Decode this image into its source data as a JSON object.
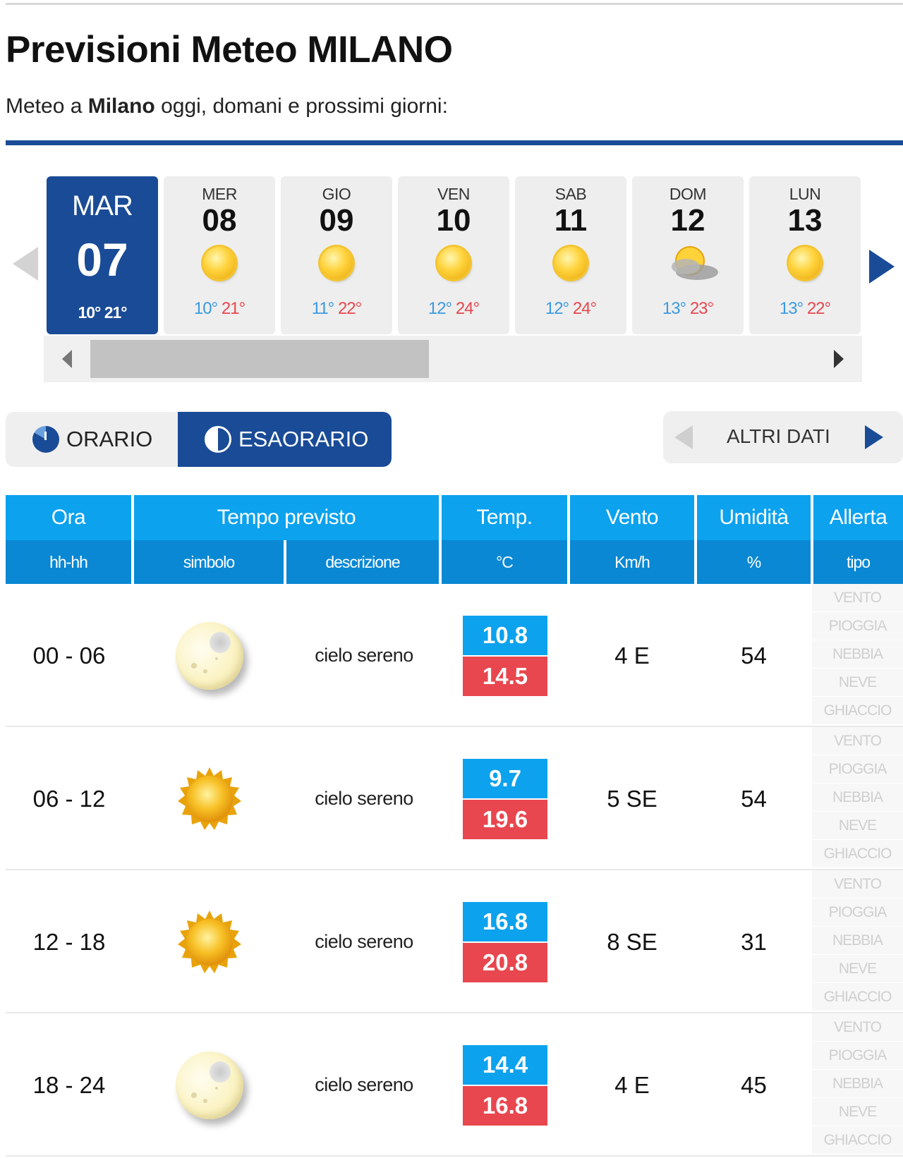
{
  "header": {
    "title": "Previsioni Meteo MILANO",
    "subtitle_pre": "Meteo a ",
    "subtitle_city": "Milano",
    "subtitle_post": " oggi, domani e prossimi giorni:"
  },
  "days": [
    {
      "name": "MAR",
      "num": "07",
      "min": "10°",
      "max": "21°",
      "icon": "sun-icon"
    },
    {
      "name": "MER",
      "num": "08",
      "min": "10°",
      "max": "21°",
      "icon": "sun-icon"
    },
    {
      "name": "GIO",
      "num": "09",
      "min": "11°",
      "max": "22°",
      "icon": "sun-icon"
    },
    {
      "name": "VEN",
      "num": "10",
      "min": "12°",
      "max": "24°",
      "icon": "sun-icon"
    },
    {
      "name": "SAB",
      "num": "11",
      "min": "12°",
      "max": "24°",
      "icon": "sun-icon"
    },
    {
      "name": "DOM",
      "num": "12",
      "min": "13°",
      "max": "23°",
      "icon": "partly-cloudy-icon"
    },
    {
      "name": "LUN",
      "num": "13",
      "min": "13°",
      "max": "22°",
      "icon": "sun-icon"
    }
  ],
  "toggle": {
    "orario": "ORARIO",
    "esaorario": "ESAORARIO",
    "active": "esaorario"
  },
  "altri": "ALTRI DATI",
  "table": {
    "headers": {
      "ora": "Ora",
      "tempo": "Tempo previsto",
      "temp": "Temp.",
      "vento": "Vento",
      "umidita": "Umidità",
      "allerta": "Allerta"
    },
    "subheaders": {
      "ora": "hh-hh",
      "simbolo": "simbolo",
      "descrizione": "descrizione",
      "temp": "°C",
      "vento": "Km/h",
      "umidita": "%",
      "allerta": "tipo"
    },
    "alert_types": [
      "VENTO",
      "PIOGGIA",
      "NEBBIA",
      "NEVE",
      "GHIACCIO"
    ],
    "rows": [
      {
        "ora": "00 - 06",
        "icon": "moon-icon",
        "desc": "cielo sereno",
        "tmin": "10.8",
        "tmax": "14.5",
        "vento": "4 E",
        "umidita": "54"
      },
      {
        "ora": "06 - 12",
        "icon": "sun-icon",
        "desc": "cielo sereno",
        "tmin": "9.7",
        "tmax": "19.6",
        "vento": "5 SE",
        "umidita": "54"
      },
      {
        "ora": "12 - 18",
        "icon": "sun-icon",
        "desc": "cielo sereno",
        "tmin": "16.8",
        "tmax": "20.8",
        "vento": "8 SE",
        "umidita": "31"
      },
      {
        "ora": "18 - 24",
        "icon": "moon-icon",
        "desc": "cielo sereno",
        "tmin": "14.4",
        "tmax": "16.8",
        "vento": "4 E",
        "umidita": "45"
      }
    ]
  },
  "colors": {
    "brand": "#1a4b96",
    "header_light": "#0ca2ee",
    "header_dark": "#0a88d3",
    "temp_min": "#3b9ae1",
    "temp_max": "#e8474f"
  }
}
